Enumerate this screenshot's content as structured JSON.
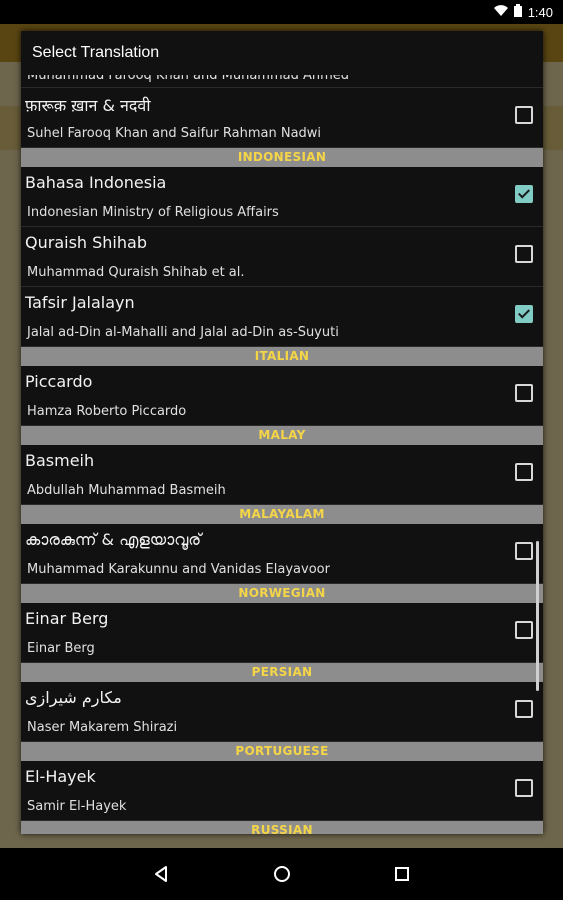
{
  "status_bar": {
    "time": "1:40"
  },
  "dialog": {
    "title": "Select Translation",
    "partial_top": {
      "subtitle": "Muhammad Farooq Khan and Muhammad Ahmed"
    },
    "rows": [
      {
        "kind": "item",
        "title": "फ़ारूक़ ख़ान & नदवी",
        "subtitle": "Suhel Farooq Khan and Saifur Rahman Nadwi",
        "checked": false
      },
      {
        "kind": "section",
        "label": "INDONESIAN"
      },
      {
        "kind": "item",
        "title": "Bahasa Indonesia",
        "subtitle": "Indonesian Ministry of Religious Affairs",
        "checked": true
      },
      {
        "kind": "item",
        "title": "Quraish Shihab",
        "subtitle": "Muhammad Quraish Shihab et al.",
        "checked": false
      },
      {
        "kind": "item",
        "title": "Tafsir Jalalayn",
        "subtitle": "Jalal ad-Din al-Mahalli and Jalal ad-Din as-Suyuti",
        "checked": true
      },
      {
        "kind": "section",
        "label": "ITALIAN"
      },
      {
        "kind": "item",
        "title": "Piccardo",
        "subtitle": "Hamza Roberto Piccardo",
        "checked": false
      },
      {
        "kind": "section",
        "label": "MALAY"
      },
      {
        "kind": "item",
        "title": "Basmeih",
        "subtitle": "Abdullah Muhammad Basmeih",
        "checked": false
      },
      {
        "kind": "section",
        "label": "MALAYALAM"
      },
      {
        "kind": "item",
        "title": "കാരകുന്ന് & എളയാവൂര്",
        "subtitle": "Muhammad Karakunnu and Vanidas Elayavoor",
        "checked": false
      },
      {
        "kind": "section",
        "label": "NORWEGIAN"
      },
      {
        "kind": "item",
        "title": "Einar Berg",
        "subtitle": "Einar Berg",
        "checked": false
      },
      {
        "kind": "section",
        "label": "PERSIAN"
      },
      {
        "kind": "item",
        "title": "مکارم شیرازی",
        "subtitle": "Naser Makarem Shirazi",
        "checked": false
      },
      {
        "kind": "section",
        "label": "PORTUGUESE"
      },
      {
        "kind": "item",
        "title": "El-Hayek",
        "subtitle": "Samir El-Hayek",
        "checked": false
      },
      {
        "kind": "section",
        "label": "RUSSIAN"
      }
    ]
  },
  "colors": {
    "section_bg": "#8d8d8d",
    "section_text": "#f5d548",
    "check_on": "#80cbc4"
  }
}
